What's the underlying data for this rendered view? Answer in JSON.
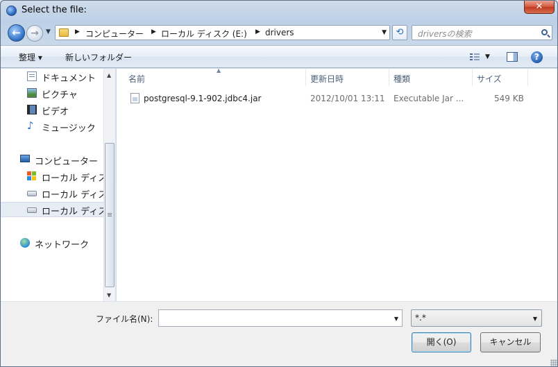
{
  "window": {
    "title": "Select the file:",
    "close": "✕"
  },
  "address": {
    "crumbs": [
      "コンピューター",
      "ローカル ディスク (E:)",
      "drivers"
    ]
  },
  "search": {
    "placeholder": "driversの検索"
  },
  "toolbar": {
    "organize": "整理 ▾",
    "new_folder": "新しいフォルダー"
  },
  "nav": {
    "items": [
      {
        "label": "ドキュメント",
        "icon": "document-icon"
      },
      {
        "label": "ピクチャ",
        "icon": "picture-icon"
      },
      {
        "label": "ビデオ",
        "icon": "video-icon"
      },
      {
        "label": "ミュージック",
        "icon": "music-icon"
      },
      {
        "label": "コンピューター",
        "icon": "computer-icon"
      },
      {
        "label": "ローカル ディスク",
        "icon": "windows-drive-icon"
      },
      {
        "label": "ローカル ディスク",
        "icon": "drive-icon"
      },
      {
        "label": "ローカル ディスク",
        "icon": "drive-icon",
        "selected": true
      },
      {
        "label": "ネットワーク",
        "icon": "network-icon"
      }
    ]
  },
  "columns": {
    "name": "名前",
    "modified": "更新日時",
    "type": "種類",
    "size": "サイズ"
  },
  "files": [
    {
      "name": "postgresql-9.1-902.jdbc4.jar",
      "modified": "2012/10/01 13:11",
      "type": "Executable Jar ...",
      "size": "549 KB"
    }
  ],
  "bottom": {
    "filename_label": "ファイル名(N):",
    "filename_value": "",
    "filter": "*.*",
    "open": "開く(O)",
    "cancel": "キャンセル"
  },
  "colors": {
    "accent": "#2d6fc4",
    "close": "#c13a20"
  }
}
